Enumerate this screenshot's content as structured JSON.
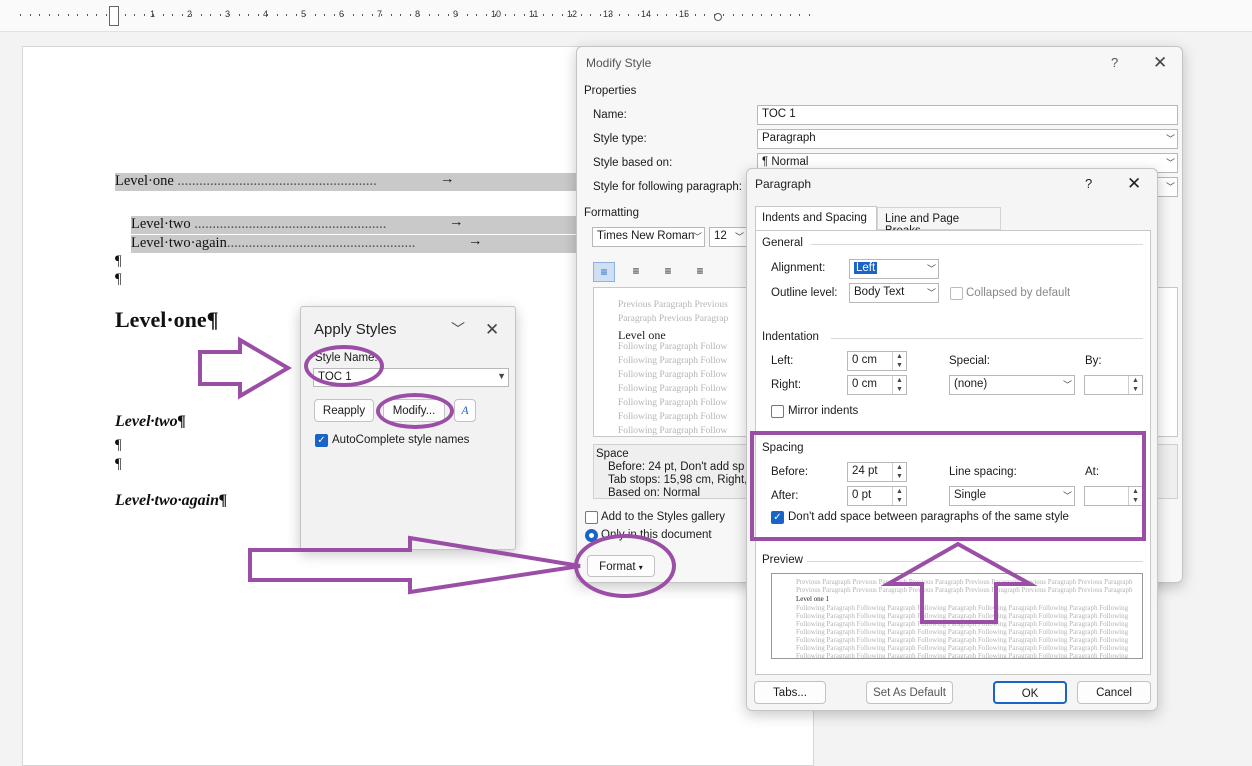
{
  "ruler": {
    "numbers": [
      "1",
      "1",
      "2",
      "3",
      "4",
      "5",
      "6",
      "7",
      "8",
      "9",
      "10",
      "11",
      "12",
      "13",
      "14",
      "15"
    ]
  },
  "document": {
    "toc_level_one": "Level·one",
    "toc_level_two": "Level·two",
    "toc_level_two_again": "Level·two·again",
    "pilcrow": "¶",
    "heading1": "Level·one¶",
    "heading2": "Level·two¶",
    "heading2b": "Level·two·again¶",
    "arrow": "→"
  },
  "apply_styles": {
    "title": "Apply Styles",
    "style_name_label": "Style Name:",
    "style_name_value": "TOC 1",
    "reapply": "Reapply",
    "modify": "Modify...",
    "autocomplete": "AutoComplete style names"
  },
  "modify_style": {
    "title": "Modify Style",
    "properties": "Properties",
    "name_label": "Name:",
    "name_value": "TOC 1",
    "style_type_label": "Style type:",
    "style_type_value": "Paragraph",
    "based_on_label": "Style based on:",
    "based_on_value": "¶  Normal",
    "following_label": "Style for following paragraph:",
    "formatting": "Formatting",
    "font": "Times New Roman",
    "size": "12",
    "preview_lines": [
      "Previous Paragraph Previous",
      "Paragraph Previous Paragrap",
      "Level one",
      "Following Paragraph Follow",
      "Following Paragraph Follow",
      "Following Paragraph Follow",
      "Following Paragraph Follow",
      "Following Paragraph Follow",
      "Following Paragraph Follow",
      "Following Paragraph Follow"
    ],
    "desc_title": "Space",
    "desc_lines": [
      "Before:  24 pt, Don't add sp",
      "Tab stops:  15,98 cm, Right,",
      "Based on: Normal"
    ],
    "add_gallery": "Add to the Styles gallery",
    "only_doc": "Only in this document",
    "format_btn": "Format"
  },
  "paragraph": {
    "title": "Paragraph",
    "tab1": "Indents and Spacing",
    "tab2": "Line and Page Breaks",
    "general": "General",
    "alignment_label": "Alignment:",
    "alignment_value": "Left",
    "outline_label": "Outline level:",
    "outline_value": "Body Text",
    "collapsed": "Collapsed by default",
    "indentation": "Indentation",
    "left_label": "Left:",
    "left_value": "0 cm",
    "right_label": "Right:",
    "right_value": "0 cm",
    "special_label": "Special:",
    "special_value": "(none)",
    "by_label": "By:",
    "mirror": "Mirror indents",
    "spacing": "Spacing",
    "before_label": "Before:",
    "before_value": "24 pt",
    "after_label": "After:",
    "after_value": "0 pt",
    "line_spacing_label": "Line spacing:",
    "line_spacing_value": "Single",
    "at_label": "At:",
    "dont_add": "Don't add space between paragraphs of the same style",
    "preview": "Preview",
    "preview_prev": "Previous Paragraph Previous Paragraph Previous Paragraph Previous Paragraph Previous Paragraph Previous Paragraph",
    "preview_cur": "Level one     1",
    "preview_follow": "Following Paragraph Following Paragraph Following Paragraph Following Paragraph Following Paragraph Following",
    "tabs_btn": "Tabs...",
    "default_btn": "Set As Default",
    "ok_btn": "OK",
    "cancel_btn": "Cancel"
  },
  "colors": {
    "annotation": "#9b4ea6",
    "accent": "#1a63c7"
  }
}
